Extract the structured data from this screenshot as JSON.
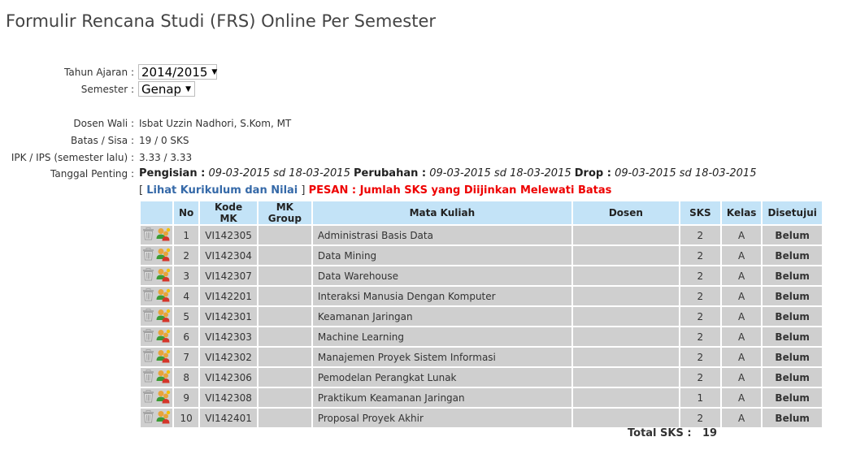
{
  "page": {
    "title": "Formulir Rencana Studi (FRS) Online Per Semester"
  },
  "form": {
    "tahun_label": "Tahun Ajaran :",
    "tahun_value": "2014/2015",
    "semester_label": "Semester :",
    "semester_value": "Genap",
    "dosen_wali_label": "Dosen Wali :",
    "dosen_wali_value": "Isbat Uzzin Nadhori, S.Kom, MT",
    "batas_label": "Batas / Sisa :",
    "batas_value": "19 / 0 SKS",
    "ipk_label": "IPK / IPS (semester lalu) :",
    "ipk_value": "3.33 / 3.33",
    "tanggal_label": "Tanggal Penting :",
    "pengisian_label": "Pengisian :",
    "pengisian_value": "09-03-2015 sd 18-03-2015",
    "perubahan_label": "Perubahan :",
    "perubahan_value": "09-03-2015 sd 18-03-2015",
    "drop_label": "Drop :",
    "drop_value": "09-03-2015 sd 18-03-2015"
  },
  "links": {
    "bracket_open": "[",
    "kurikulum": "Lihat Kurikulum dan Nilai",
    "bracket_close": "]",
    "pesan": "PESAN : Jumlah SKS yang Diijinkan Melewati Batas"
  },
  "table": {
    "headers": [
      "No",
      "Kode MK",
      "MK Group",
      "Mata Kuliah",
      "Dosen",
      "SKS",
      "Kelas",
      "Disetujui"
    ],
    "rows": [
      {
        "no": "1",
        "kode": "VI142305",
        "group": "",
        "mk": "Administrasi Basis Data",
        "dosen": "",
        "sks": "2",
        "kelas": "A",
        "status": "Belum"
      },
      {
        "no": "2",
        "kode": "VI142304",
        "group": "",
        "mk": "Data Mining",
        "dosen": "",
        "sks": "2",
        "kelas": "A",
        "status": "Belum"
      },
      {
        "no": "3",
        "kode": "VI142307",
        "group": "",
        "mk": "Data Warehouse",
        "dosen": "",
        "sks": "2",
        "kelas": "A",
        "status": "Belum"
      },
      {
        "no": "4",
        "kode": "VI142201",
        "group": "",
        "mk": "Interaksi Manusia Dengan Komputer",
        "dosen": "",
        "sks": "2",
        "kelas": "A",
        "status": "Belum"
      },
      {
        "no": "5",
        "kode": "VI142301",
        "group": "",
        "mk": "Keamanan Jaringan",
        "dosen": "",
        "sks": "2",
        "kelas": "A",
        "status": "Belum"
      },
      {
        "no": "6",
        "kode": "VI142303",
        "group": "",
        "mk": "Machine Learning",
        "dosen": "",
        "sks": "2",
        "kelas": "A",
        "status": "Belum"
      },
      {
        "no": "7",
        "kode": "VI142302",
        "group": "",
        "mk": "Manajemen Proyek Sistem Informasi",
        "dosen": "",
        "sks": "2",
        "kelas": "A",
        "status": "Belum"
      },
      {
        "no": "8",
        "kode": "VI142306",
        "group": "",
        "mk": "Pemodelan Perangkat Lunak",
        "dosen": "",
        "sks": "2",
        "kelas": "A",
        "status": "Belum"
      },
      {
        "no": "9",
        "kode": "VI142308",
        "group": "",
        "mk": "Praktikum Keamanan Jaringan",
        "dosen": "",
        "sks": "1",
        "kelas": "A",
        "status": "Belum"
      },
      {
        "no": "10",
        "kode": "VI142401",
        "group": "",
        "mk": "Proposal Proyek Akhir",
        "dosen": "",
        "sks": "2",
        "kelas": "A",
        "status": "Belum"
      }
    ],
    "total_label": "Total SKS :",
    "total_value": "19"
  },
  "colors": {
    "header_bg": "#c3e3f7",
    "row_bg": "#cfcfcf",
    "status_red": "#ee0000",
    "link_blue": "#3569a8"
  },
  "icons": {
    "delete": "trash-icon",
    "change_class": "user-change-icon"
  }
}
